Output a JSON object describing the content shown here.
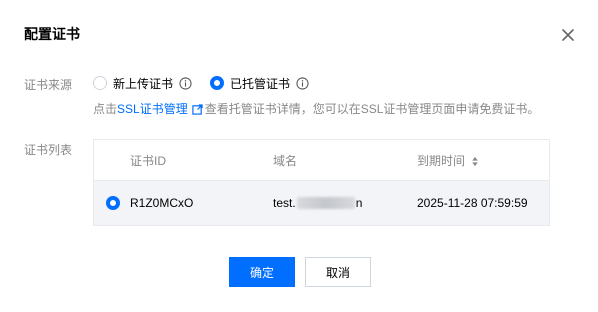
{
  "dialog": {
    "title": "配置证书",
    "close_icon": "close-icon"
  },
  "source": {
    "label": "证书来源",
    "options": [
      {
        "label": "新上传证书",
        "selected": false,
        "icon": "info-icon"
      },
      {
        "label": "已托管证书",
        "selected": true,
        "icon": "info-icon"
      }
    ]
  },
  "help": {
    "prefix": "点击",
    "link": "SSL证书管理",
    "link_icon": "external-link-icon",
    "suffix": "查看托管证书详情，您可以在SSL证书管理页面申请免费证书。"
  },
  "cert_list": {
    "label": "证书列表",
    "columns": {
      "id": "证书ID",
      "domain": "域名",
      "expire": "到期时间",
      "expire_sort_icon": "sort-icon"
    },
    "rows": [
      {
        "selected": true,
        "id": "R1Z0MCxO",
        "domain_prefix": "test.",
        "domain_suffix": "n",
        "expire": "2025-11-28 07:59:59"
      }
    ]
  },
  "buttons": {
    "confirm": "确定",
    "cancel": "取消"
  },
  "colors": {
    "primary": "#006eff",
    "muted_text": "#888888",
    "border": "#e6e9ee",
    "selected_row": "#f2f4f8"
  }
}
